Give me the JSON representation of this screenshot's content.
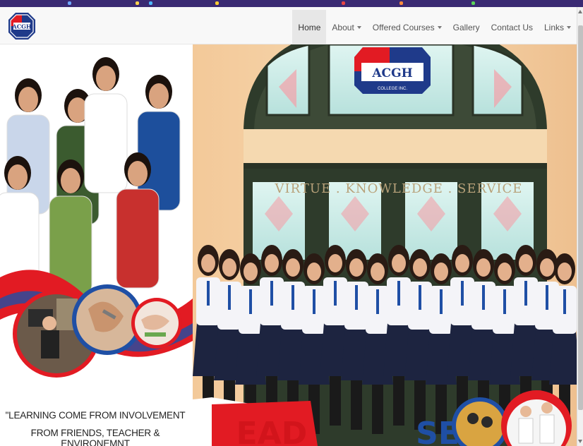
{
  "browser": {
    "top_strip_color": "#3a2a73"
  },
  "header": {
    "logo": {
      "icon": "school-logo-icon",
      "text": "ACGH"
    },
    "nav": [
      {
        "label": "Home",
        "active": true,
        "dropdown": false
      },
      {
        "label": "About",
        "active": false,
        "dropdown": true
      },
      {
        "label": "Offered Courses",
        "active": false,
        "dropdown": true
      },
      {
        "label": "Gallery",
        "active": false,
        "dropdown": false
      },
      {
        "label": "Contact Us",
        "active": false,
        "dropdown": false
      },
      {
        "label": "Links",
        "active": false,
        "dropdown": true
      }
    ]
  },
  "hero": {
    "building_logo_text": "ACGH",
    "building_logo_sub": "COLLEGE INC.",
    "motto": "VIRTUE . KNOWLEDGE . SERVICE",
    "quote_line1": "\"LEARNING COME FROM INVOLVEMENT",
    "quote_line2": "FROM FRIENDS, TEACHER & ENVIRONEMNT",
    "banner_text_left": "EAD",
    "banner_text_right": "SE",
    "colors": {
      "brand_red": "#e21b23",
      "brand_blue": "#1f4fa5",
      "uniform_navy": "#1d2440"
    }
  }
}
